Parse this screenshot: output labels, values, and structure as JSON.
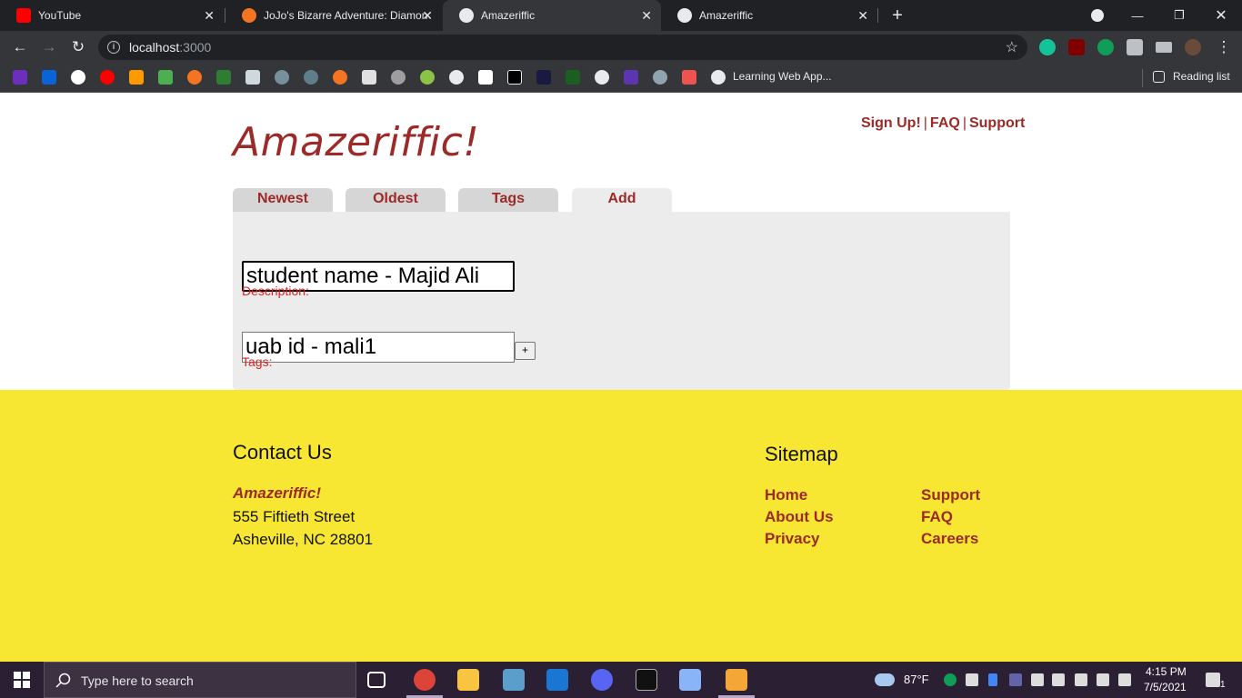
{
  "browser": {
    "tabs": [
      {
        "label": "YouTube",
        "favicon_color": "#ff0000"
      },
      {
        "label": "JoJo's Bizarre Adventure: Diamon",
        "favicon_color": "#f47521"
      },
      {
        "label": "Amazeriffic",
        "favicon_color": "#e8eaed",
        "active": true
      },
      {
        "label": "Amazeriffic",
        "favicon_color": "#e8eaed"
      }
    ],
    "new_tab_symbol": "+",
    "close_symbol": "✕",
    "url_host": "localhost",
    "url_port": ":3000",
    "bookmarks_text": "Learning Web App...",
    "reading_list": "Reading list"
  },
  "site": {
    "title": "Amazeriffic!",
    "nav": [
      "Sign Up!",
      "FAQ",
      "Support"
    ],
    "nav_sep": "|",
    "tabs": [
      "Newest",
      "Oldest",
      "Tags",
      "Add"
    ],
    "active_tab": "Add",
    "description_value": "student name - Majid Ali",
    "description_label": "Description:",
    "tags_value": "uab id - mali1",
    "tags_label": "Tags:",
    "add_button": "+"
  },
  "footer": {
    "contact_heading": "Contact Us",
    "brand": "Amazeriffic!",
    "address_line1": "555 Fiftieth Street",
    "address_line2": "Asheville, NC 28801",
    "sitemap_heading": "Sitemap",
    "links_col1": [
      "Home",
      "About Us",
      "Privacy"
    ],
    "links_col2": [
      "Support",
      "FAQ",
      "Careers"
    ]
  },
  "taskbar": {
    "search_placeholder": "Type here to search",
    "weather": "87°F",
    "time": "4:15 PM",
    "date": "7/5/2021",
    "notification_count": "1"
  },
  "colors": {
    "accent": "#9c2a28",
    "footer_bg": "#f7e733",
    "label_red": "#e02020"
  }
}
